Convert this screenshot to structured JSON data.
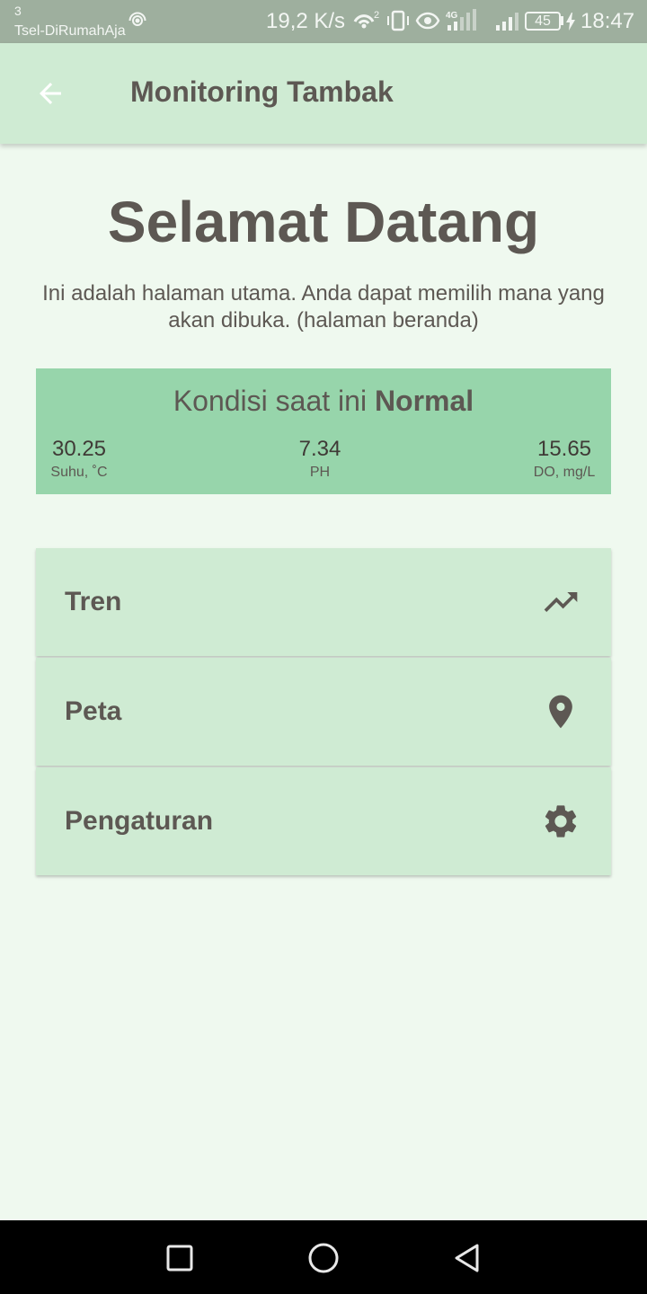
{
  "status_bar": {
    "carrier_number": "3",
    "carrier": "Tsel-DiRumahAja",
    "speed": "19,2 K/s",
    "network_label": "4G",
    "battery": "45",
    "time": "18:47",
    "icons": [
      "hotspot-icon",
      "wifi-calling-icon",
      "vibrate-icon",
      "eye-icon",
      "signal-4g-icon",
      "signal-icon",
      "battery-icon",
      "charging-icon"
    ]
  },
  "app_bar": {
    "title": "Monitoring Tambak",
    "back_icon": "arrow-back-icon"
  },
  "welcome": {
    "title": "Selamat Datang",
    "description": "Ini adalah halaman utama. Anda dapat memilih mana yang akan dibuka. (halaman beranda)"
  },
  "condition": {
    "prefix": "Kondisi saat ini",
    "status": "Normal",
    "metrics": [
      {
        "value": "30.25",
        "label": "Suhu, ˚C"
      },
      {
        "value": "7.34",
        "label": "PH"
      },
      {
        "value": "15.65",
        "label": "DO, mg/L"
      }
    ]
  },
  "menu": [
    {
      "label": "Tren",
      "icon": "trending-up-icon"
    },
    {
      "label": "Peta",
      "icon": "location-pin-icon"
    },
    {
      "label": "Pengaturan",
      "icon": "gear-icon"
    }
  ],
  "nav_bar": {
    "icons": [
      "recent-apps-icon",
      "home-icon",
      "back-icon"
    ]
  },
  "colors": {
    "status_bar": "#9eaf9e",
    "app_bar": "#cfebd3",
    "background": "#eff9ef",
    "condition_card": "#97d5ab",
    "menu_card": "#cfebd3",
    "text": "#5d5853",
    "nav_bar": "#000000"
  }
}
